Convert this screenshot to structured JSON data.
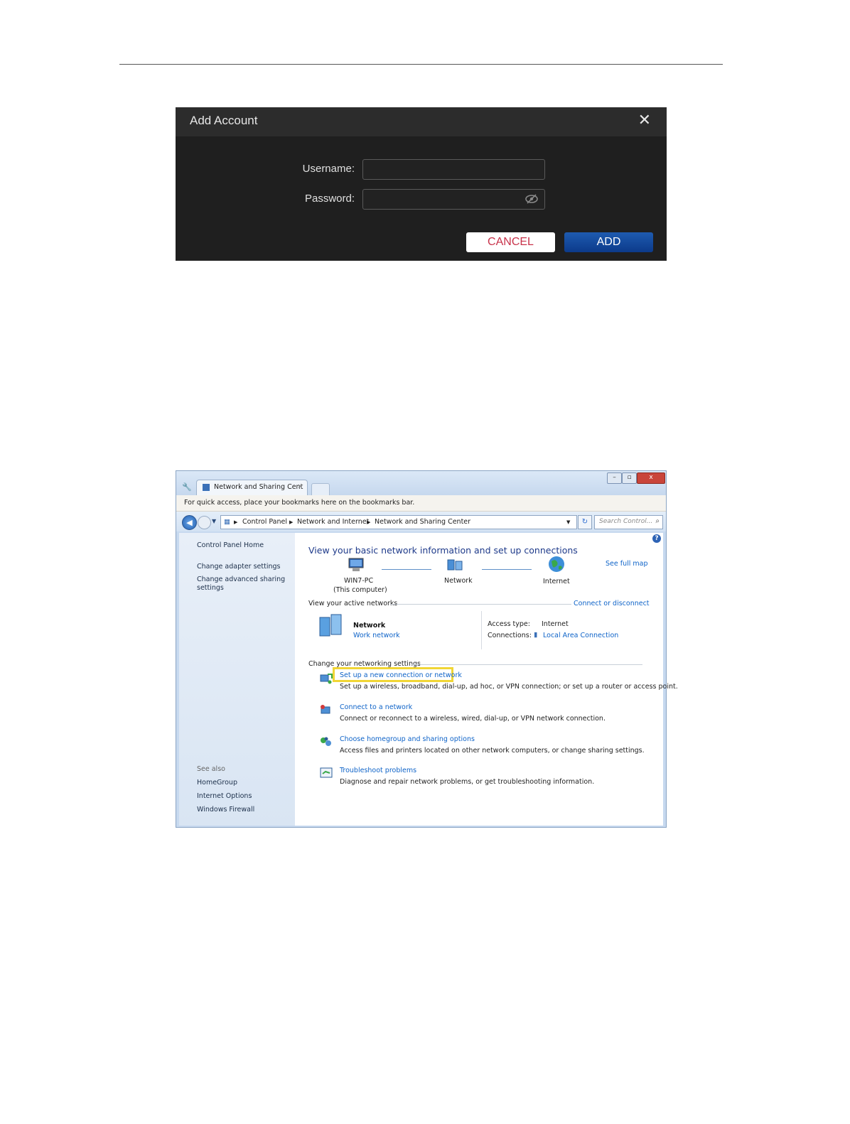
{
  "dialog": {
    "title": "Add Account",
    "close_glyph": "✕",
    "username_label": "Username:",
    "password_label": "Password:",
    "username_value": "",
    "password_value": "",
    "cancel_label": "CANCEL",
    "add_label": "ADD",
    "colors": {
      "cancel_text": "#c8324a",
      "add_bg": "#1e5bb0"
    }
  },
  "browser": {
    "tab_label": "Network and Sharing Cent",
    "tab_close": "×",
    "bookmarks_hint": "For quick access, place your bookmarks here on the bookmarks bar.",
    "breadcrumb": [
      "Control Panel",
      "Network and Internet",
      "Network and Sharing Center"
    ],
    "search_placeholder": "Search Control..."
  },
  "sidebar": {
    "home": "Control Panel Home",
    "links": [
      "Change adapter settings",
      "Change advanced sharing",
      "settings"
    ],
    "see_also_title": "See also",
    "see_also": [
      "HomeGroup",
      "Internet Options",
      "Windows Firewall"
    ]
  },
  "main": {
    "heading": "View your basic network information and set up connections",
    "see_full_map": "See full map",
    "map": {
      "computer_name": "WIN7-PC",
      "computer_sub": "(This computer)",
      "network": "Network",
      "internet": "Internet"
    },
    "active_networks_title": "View your active networks",
    "connect_disconnect": "Connect or disconnect",
    "active_network": {
      "name": "Network",
      "type": "Work network",
      "access_type_label": "Access type:",
      "access_type_value": "Internet",
      "connections_label": "Connections:",
      "connections_value": "Local Area Connection"
    },
    "change_settings_title": "Change your networking settings",
    "tasks": [
      {
        "title": "Set up a new connection or network",
        "desc": "Set up a wireless, broadband, dial-up, ad hoc, or VPN connection; or set up a router or access point."
      },
      {
        "title": "Connect to a network",
        "desc": "Connect or reconnect to a wireless, wired, dial-up, or VPN network connection."
      },
      {
        "title": "Choose homegroup and sharing options",
        "desc": "Access files and printers located on other network computers, or change sharing settings."
      },
      {
        "title": "Troubleshoot problems",
        "desc": "Diagnose and repair network problems, or get troubleshooting information."
      }
    ],
    "highlight_color": "#f1d635"
  }
}
